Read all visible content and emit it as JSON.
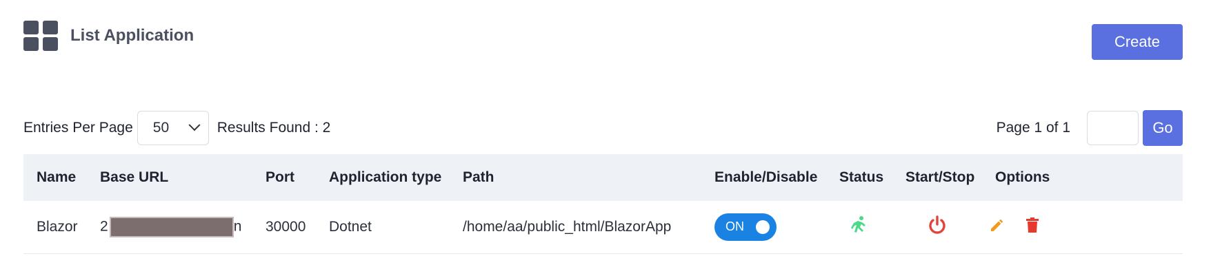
{
  "header": {
    "title": "List Application",
    "create_label": "Create",
    "icon": "grid-icon"
  },
  "toolbar": {
    "entries_label": "Entries Per Page",
    "entries_value": "50",
    "results_label": "Results Found : 2"
  },
  "pager": {
    "page_text": "Page 1 of 1",
    "page_input_value": "",
    "go_label": "Go"
  },
  "table": {
    "columns": [
      "Name",
      "Base URL",
      "Port",
      "Application type",
      "Path",
      "Enable/Disable",
      "Status",
      "Start/Stop",
      "Options"
    ],
    "rows": [
      {
        "name": "Blazor",
        "base_url_start": "2",
        "base_url_end": "n",
        "port": "30000",
        "app_type": "Dotnet",
        "path": "/home/aa/public_html/BlazorApp",
        "toggle": "ON",
        "status_icon": "running-person-icon",
        "start_stop_icon": "power-icon",
        "option_icons": [
          "pencil-icon",
          "trash-icon"
        ]
      }
    ]
  },
  "colors": {
    "accent": "#5a6fe0",
    "toggle": "#1a82e2",
    "status_green": "#4cd98a",
    "power_red": "#e0443c",
    "edit_orange": "#f39a1c",
    "delete_red": "#e43a2f"
  }
}
